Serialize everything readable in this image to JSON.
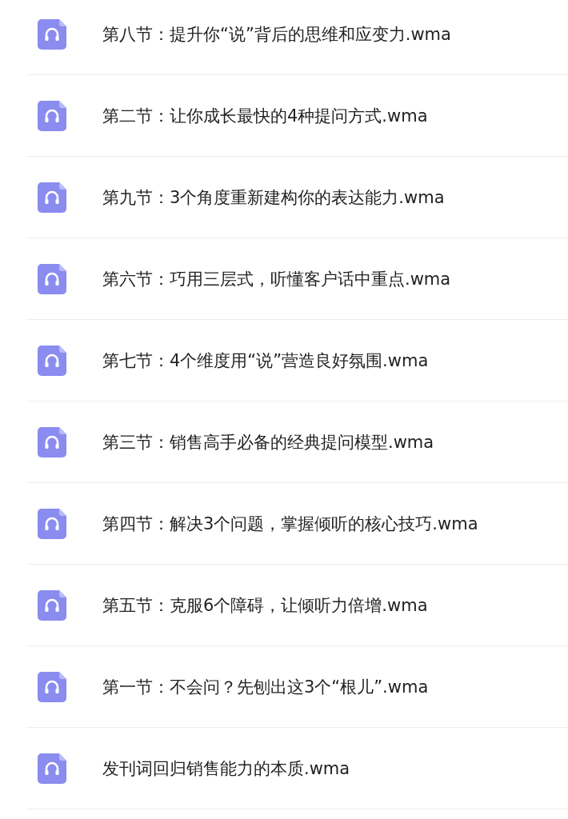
{
  "files": [
    {
      "name": "第八节：提升你“说”背后的思维和应变力.wma"
    },
    {
      "name": "第二节：让你成长最快的4种提问方式.wma"
    },
    {
      "name": "第九节：3个角度重新建构你的表达能力.wma"
    },
    {
      "name": "第六节：巧用三层式，听懂客户话中重点.wma"
    },
    {
      "name": "第七节：4个维度用“说”营造良好氛围.wma"
    },
    {
      "name": "第三节：销售高手必备的经典提问模型.wma"
    },
    {
      "name": "第四节：解决3个问题，掌握倾听的核心技巧.wma"
    },
    {
      "name": "第五节：克服6个障碍，让倾听力倍增.wma"
    },
    {
      "name": "第一节：不会问？先刨出这3个“根儿”.wma"
    },
    {
      "name": "发刊词回归销售能力的本质.wma"
    }
  ]
}
